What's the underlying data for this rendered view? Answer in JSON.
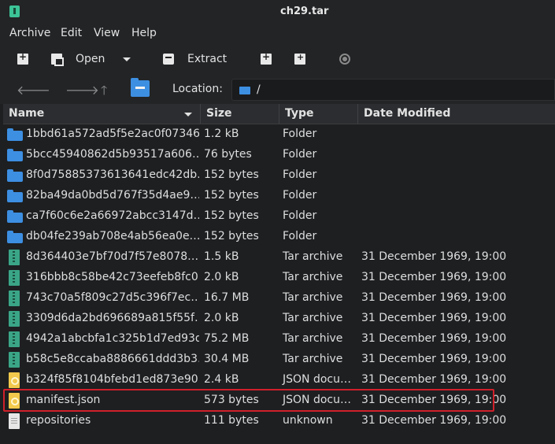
{
  "window": {
    "title": "ch29.tar"
  },
  "menubar": {
    "items": [
      "Archive",
      "Edit",
      "View",
      "Help"
    ]
  },
  "toolbar": {
    "open_label": "Open",
    "extract_label": "Extract"
  },
  "navbar": {
    "location_label": "Location:",
    "location_value": "/"
  },
  "columns": {
    "name": "Name",
    "size": "Size",
    "type": "Type",
    "date": "Date Modified"
  },
  "files": [
    {
      "name": "1bbd61a572ad5f5e2ac0f07346…",
      "size": "1.2 kB",
      "type": "Folder",
      "date": "",
      "icon": "folder-icon"
    },
    {
      "name": "5bcc45940862d5b93517a606…",
      "size": "76 bytes",
      "type": "Folder",
      "date": "",
      "icon": "folder-icon"
    },
    {
      "name": "8f0d75885373613641edc42db…",
      "size": "152 bytes",
      "type": "Folder",
      "date": "",
      "icon": "folder-icon"
    },
    {
      "name": "82ba49da0bd5d767f35d4ae9…",
      "size": "152 bytes",
      "type": "Folder",
      "date": "",
      "icon": "folder-icon"
    },
    {
      "name": "ca7f60c6e2a66972abcc3147d…",
      "size": "152 bytes",
      "type": "Folder",
      "date": "",
      "icon": "folder-icon"
    },
    {
      "name": "db04fe239ab708e4ab56ea0e…",
      "size": "152 bytes",
      "type": "Folder",
      "date": "",
      "icon": "folder-icon"
    },
    {
      "name": "8d364403e7bf70d7f57e8078…",
      "size": "1.5 kB",
      "type": "Tar archive",
      "date": "31 December 1969, 19:00",
      "icon": "tar-archive-icon"
    },
    {
      "name": "316bbb8c58be42c73eefeb8fc0…",
      "size": "2.0 kB",
      "type": "Tar archive",
      "date": "31 December 1969, 19:00",
      "icon": "tar-archive-icon"
    },
    {
      "name": "743c70a5f809c27d5c396f7ec…",
      "size": "16.7 MB",
      "type": "Tar archive",
      "date": "31 December 1969, 19:00",
      "icon": "tar-archive-icon"
    },
    {
      "name": "3309d6da2bd696689a815f55f…",
      "size": "2.0 kB",
      "type": "Tar archive",
      "date": "31 December 1969, 19:00",
      "icon": "tar-archive-icon"
    },
    {
      "name": "4942a1abcbfa1c325b1d7ed93d…",
      "size": "75.2 MB",
      "type": "Tar archive",
      "date": "31 December 1969, 19:00",
      "icon": "tar-archive-icon"
    },
    {
      "name": "b58c5e8ccaba8886661ddd3b3…",
      "size": "30.4 MB",
      "type": "Tar archive",
      "date": "31 December 1969, 19:00",
      "icon": "tar-archive-icon"
    },
    {
      "name": "b324f85f8104bfebd1ed873e90…",
      "size": "2.4 kB",
      "type": "JSON docu…",
      "date": "31 December 1969, 19:00",
      "icon": "json-file-icon"
    },
    {
      "name": "manifest.json",
      "size": "573 bytes",
      "type": "JSON docu…",
      "date": "31 December 1969, 19:00",
      "icon": "json-file-icon"
    },
    {
      "name": "repositories",
      "size": "111 bytes",
      "type": "unknown",
      "date": "31 December 1969, 19:00",
      "icon": "unknown-file-icon"
    }
  ]
}
